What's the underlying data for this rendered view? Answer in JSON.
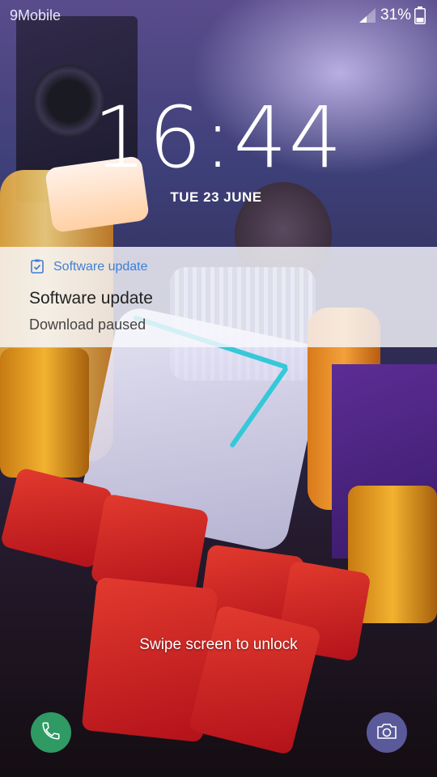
{
  "status_bar": {
    "carrier": "9Mobile",
    "battery_percent": "31%",
    "signal_icon": "signal-icon",
    "battery_icon": "battery-icon"
  },
  "lock_screen": {
    "time": "16:44",
    "date": "TUE 23 JUNE",
    "unlock_hint": "Swipe screen to unlock"
  },
  "notification": {
    "app_icon": "software-update-icon",
    "app_name": "Software update",
    "title": "Software update",
    "text": "Download paused",
    "accent_color": "#3f7fd6"
  },
  "shortcuts": {
    "left": {
      "icon": "phone-icon",
      "color": "#2f9a64"
    },
    "right": {
      "icon": "camera-icon",
      "color": "#5a5a9a"
    }
  }
}
